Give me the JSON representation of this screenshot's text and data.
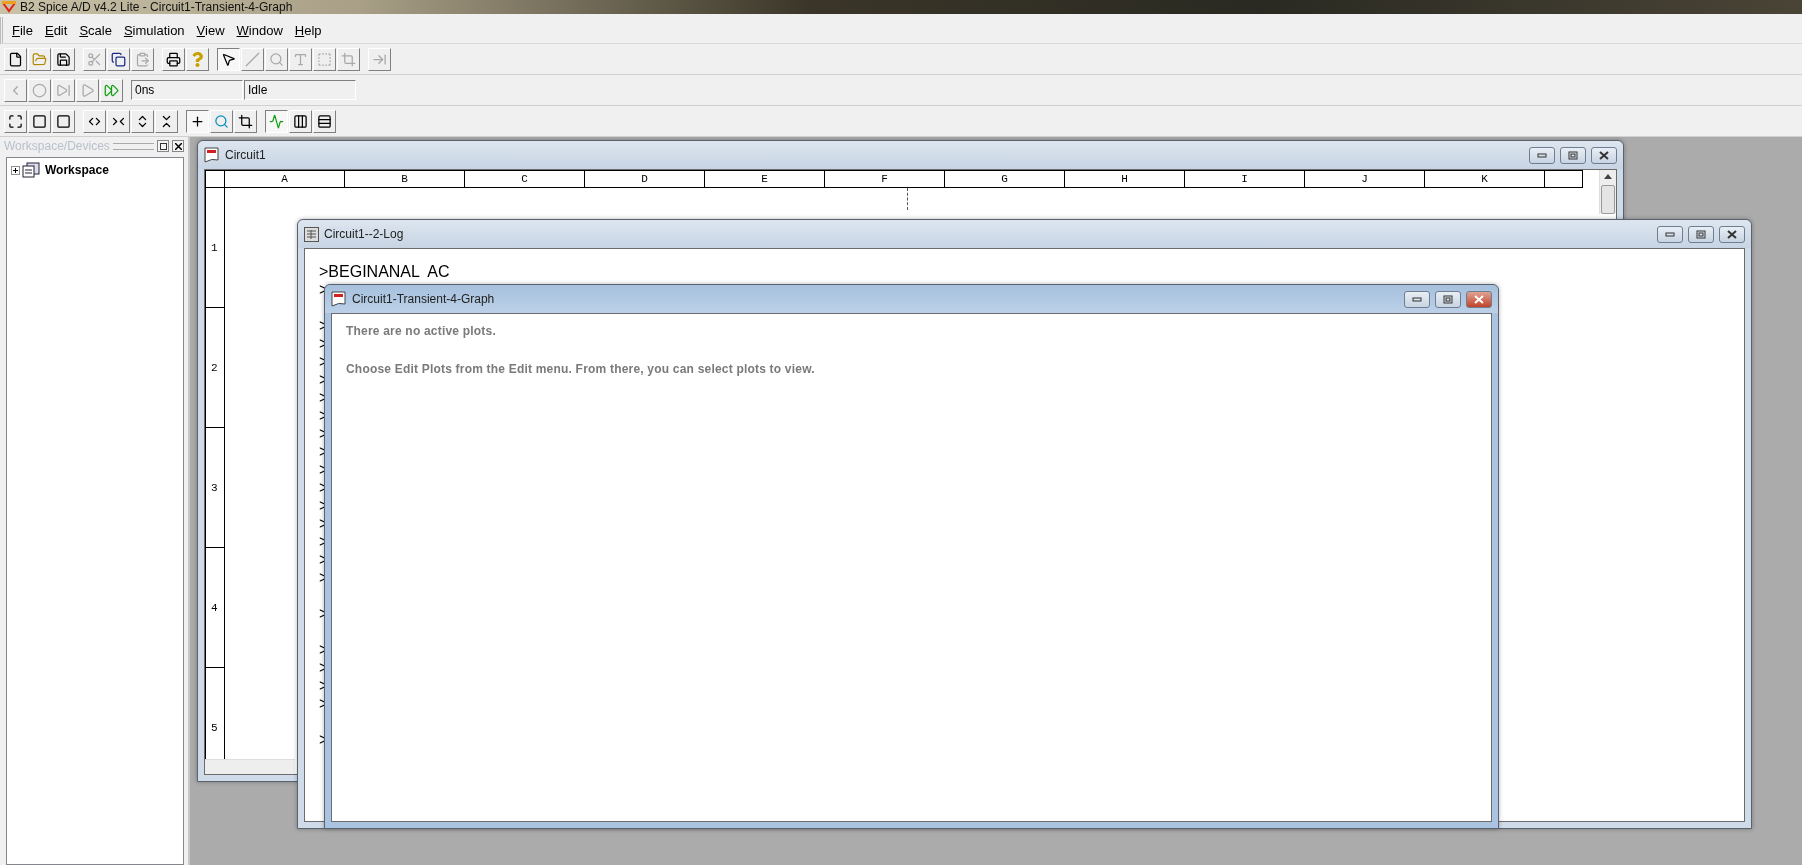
{
  "app": {
    "title": "B2 Spice A/D v4.2 Lite - Circuit1-Transient-4-Graph"
  },
  "menu": [
    "File",
    "Edit",
    "Scale",
    "Simulation",
    "View",
    "Window",
    "Help"
  ],
  "toolbars": [
    [
      [
        {
          "disabled": false,
          "pressed": false
        },
        {
          "disabled": false,
          "pressed": false
        },
        {
          "disabled": false,
          "pressed": false
        }
      ],
      [
        {
          "disabled": true,
          "pressed": false
        },
        {
          "disabled": false,
          "pressed": false
        },
        {
          "disabled": true,
          "pressed": false
        }
      ],
      [
        {
          "disabled": false,
          "pressed": false
        },
        {
          "disabled": false,
          "pressed": false
        }
      ],
      [
        {
          "disabled": false,
          "pressed": true
        },
        {
          "disabled": true,
          "pressed": false
        },
        {
          "disabled": true,
          "pressed": false
        },
        {
          "disabled": true,
          "pressed": false
        },
        {
          "disabled": true,
          "pressed": false
        },
        {
          "disabled": true,
          "pressed": false
        }
      ],
      [
        {
          "disabled": true,
          "pressed": false
        }
      ]
    ],
    [
      [
        {
          "disabled": true,
          "pressed": false
        },
        {
          "disabled": true,
          "pressed": false
        },
        {
          "disabled": true,
          "pressed": false
        },
        {
          "disabled": true,
          "pressed": false
        },
        {
          "disabled": false,
          "pressed": false
        }
      ]
    ],
    [
      [
        {
          "disabled": false,
          "pressed": false
        },
        {
          "disabled": false,
          "pressed": false
        },
        {
          "disabled": false,
          "pressed": false
        }
      ],
      [
        {
          "disabled": false,
          "pressed": false
        },
        {
          "disabled": false,
          "pressed": false
        },
        {
          "disabled": false,
          "pressed": false
        },
        {
          "disabled": false,
          "pressed": false
        }
      ],
      [
        {
          "disabled": false,
          "pressed": true
        },
        {
          "disabled": false,
          "pressed": false
        },
        {
          "disabled": false,
          "pressed": false
        }
      ],
      [
        {
          "disabled": false,
          "pressed": true
        },
        {
          "disabled": false,
          "pressed": false
        },
        {
          "disabled": false,
          "pressed": false
        }
      ]
    ]
  ],
  "sim_status": {
    "time": "0ns",
    "state": "Idle"
  },
  "workspace_panel": {
    "title": "Workspace/Devices",
    "tree": [
      {
        "label": "Workspace",
        "expanded": false
      }
    ]
  },
  "windows": [
    {
      "kind": "sheet",
      "title": "Circuit1",
      "active": false,
      "columns": [
        "A",
        "B",
        "C",
        "D",
        "E",
        "F",
        "G",
        "H",
        "I",
        "J",
        "K"
      ],
      "rows": [
        "1",
        "2",
        "3",
        "4",
        "5"
      ]
    },
    {
      "kind": "log",
      "title": "Circuit1--2-Log",
      "active": false,
      "lines": [
        {
          "kind": "text",
          "text": ">BEGINANAL  AC"
        },
        {
          "kind": "text",
          "text": ">"
        },
        {
          "kind": "blank"
        },
        {
          "kind": "text",
          "text": ">"
        },
        {
          "kind": "text",
          "text": ">"
        },
        {
          "kind": "text",
          "text": ">"
        },
        {
          "kind": "text",
          "text": ">"
        },
        {
          "kind": "text",
          "text": ">"
        },
        {
          "kind": "text",
          "text": ">"
        },
        {
          "kind": "text",
          "text": ">"
        },
        {
          "kind": "text",
          "text": ">"
        },
        {
          "kind": "text",
          "text": ">"
        },
        {
          "kind": "text",
          "text": ">"
        },
        {
          "kind": "text",
          "text": ">"
        },
        {
          "kind": "text",
          "text": ">"
        },
        {
          "kind": "text",
          "text": ">"
        },
        {
          "kind": "text",
          "text": ">"
        },
        {
          "kind": "text",
          "text": ">"
        },
        {
          "kind": "blank"
        },
        {
          "kind": "text",
          "text": ">"
        },
        {
          "kind": "blank"
        },
        {
          "kind": "text",
          "text": ">"
        },
        {
          "kind": "text",
          "text": ">"
        },
        {
          "kind": "text",
          "text": ">"
        },
        {
          "kind": "text",
          "text": ">"
        },
        {
          "kind": "blank"
        },
        {
          "kind": "text",
          "text": ">"
        }
      ]
    },
    {
      "kind": "graph",
      "title": "Circuit1-Transient-4-Graph",
      "active": true,
      "messages": [
        "There are no active plots.",
        "Choose Edit Plots from the Edit menu.  From there, you can select plots to view."
      ]
    }
  ]
}
